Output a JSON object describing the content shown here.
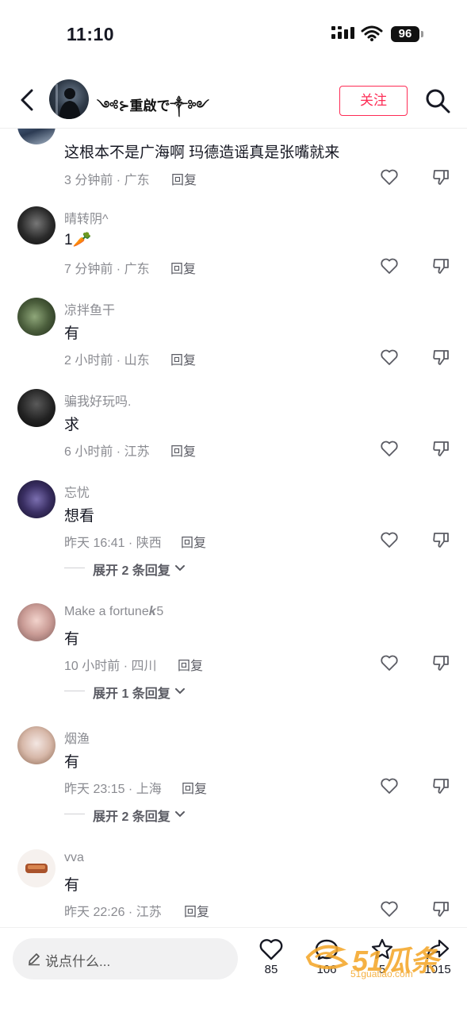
{
  "status_bar": {
    "time": "11:10",
    "battery": "96"
  },
  "header": {
    "username": "༺⊱重啟で༒༻",
    "follow_label": "关注"
  },
  "comments": [
    {
      "username": "",
      "text": "这根本不是广海啊 玛德造谣真是张嘴就来",
      "meta": "3 分钟前 · 广东",
      "reply_label": "回复"
    },
    {
      "username": "晴转阴^",
      "text": "1🥕",
      "meta": "7 分钟前 · 广东",
      "reply_label": "回复"
    },
    {
      "username": "凉拌鱼干",
      "text": "有",
      "meta": "2 小时前 · 山东",
      "reply_label": "回复"
    },
    {
      "username": "骗我好玩吗.",
      "text": "求",
      "meta": "6 小时前 · 江苏",
      "reply_label": "回复"
    },
    {
      "username": "忘忧",
      "text": "想看",
      "meta": "昨天 16:41 · 陕西",
      "reply_label": "回复",
      "expand": "展开 2 条回复"
    },
    {
      "username": "Make a fortune𝒌5",
      "text": "有",
      "meta": "10 小时前 · 四川",
      "reply_label": "回复",
      "expand": "展开 1 条回复"
    },
    {
      "username": "烟渔",
      "text": "有",
      "meta": "昨天 23:15 · 上海",
      "reply_label": "回复",
      "expand": "展开 2 条回复"
    },
    {
      "username": "vva",
      "text": "有",
      "meta": "昨天 22:26 · 江苏",
      "reply_label": "回复"
    }
  ],
  "bottom_bar": {
    "input_placeholder": "说点什么...",
    "like_count": "85",
    "comment_count": "106",
    "favorite_count": "5",
    "share_count": "1015"
  },
  "watermark": {
    "brand": "51瓜条",
    "url": "51guatiao.com"
  },
  "colors": {
    "accent": "#fe2c55",
    "text": "#161823",
    "secondary": "#8a8b91"
  },
  "icons": [
    "back-icon",
    "search-icon",
    "heart-outline-icon",
    "dislike-icon",
    "chevron-down-icon",
    "pencil-icon",
    "comment-icon",
    "star-icon",
    "share-icon"
  ]
}
